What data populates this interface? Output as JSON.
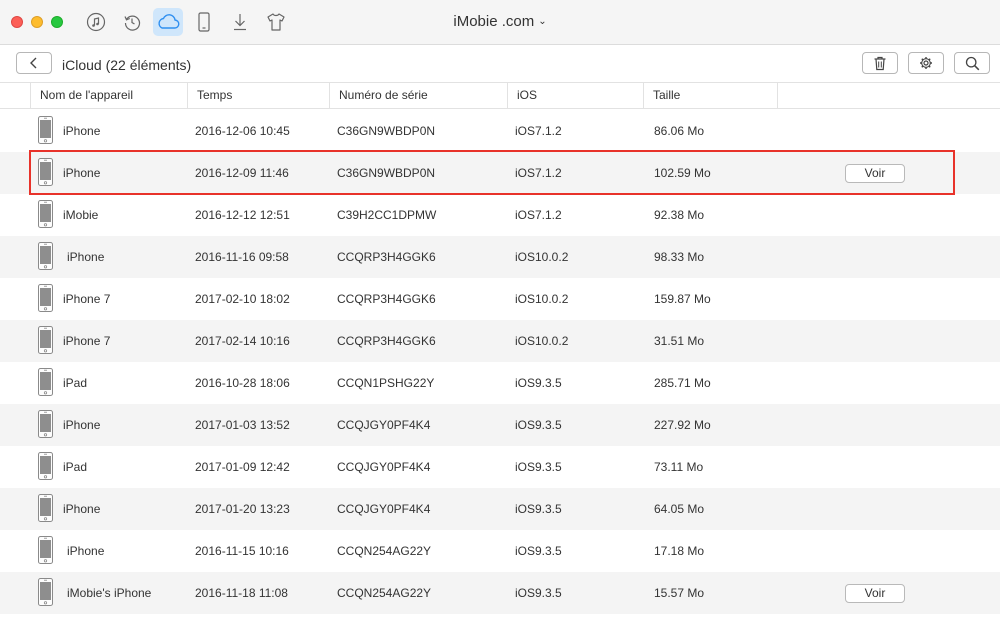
{
  "window": {
    "title": "iMobie .com",
    "title_chevron": "⌄"
  },
  "toolbar_icons": [
    {
      "name": "music-icon",
      "active": false
    },
    {
      "name": "restore-icon",
      "active": false
    },
    {
      "name": "cloud-icon",
      "active": true
    },
    {
      "name": "device-icon",
      "active": false
    },
    {
      "name": "download-icon",
      "active": false
    },
    {
      "name": "tshirt-icon",
      "active": false
    }
  ],
  "header": {
    "title": "iCloud (22 éléments)"
  },
  "columns": [
    "Nom de l'appareil",
    "Temps",
    "Numéro de série",
    "iOS",
    "Taille"
  ],
  "rows": [
    {
      "name": "iPhone",
      "time": "2016-12-06 10:45",
      "serial": "C36GN9WBDP0N",
      "ios": "iOS7.1.2",
      "size": "86.06 Mo"
    },
    {
      "name": "iPhone",
      "time": "2016-12-09 11:46",
      "serial": "C36GN9WBDP0N",
      "ios": "iOS7.1.2",
      "size": "102.59 Mo",
      "action": "Voir"
    },
    {
      "name": "iMobie",
      "time": "2016-12-12 12:51",
      "serial": "C39H2CC1DPMW",
      "ios": "iOS7.1.2",
      "size": "92.38 Mo"
    },
    {
      "name": "iPhone",
      "time": "2016-11-16 09:58",
      "serial": "CCQRP3H4GGK6",
      "ios": "iOS10.0.2",
      "size": "98.33 Mo"
    },
    {
      "name": "iPhone 7",
      "time": "2017-02-10 18:02",
      "serial": "CCQRP3H4GGK6",
      "ios": "iOS10.0.2",
      "size": "159.87 Mo"
    },
    {
      "name": "iPhone 7",
      "time": "2017-02-14 10:16",
      "serial": "CCQRP3H4GGK6",
      "ios": "iOS10.0.2",
      "size": "31.51 Mo"
    },
    {
      "name": "iPad",
      "time": "2016-10-28 18:06",
      "serial": "CCQN1PSHG22Y",
      "ios": "iOS9.3.5",
      "size": "285.71 Mo"
    },
    {
      "name": "iPhone",
      "time": "2017-01-03 13:52",
      "serial": "CCQJGY0PF4K4",
      "ios": "iOS9.3.5",
      "size": "227.92 Mo"
    },
    {
      "name": "iPad",
      "time": "2017-01-09 12:42",
      "serial": "CCQJGY0PF4K4",
      "ios": "iOS9.3.5",
      "size": "73.11 Mo"
    },
    {
      "name": "iPhone",
      "time": "2017-01-20 13:23",
      "serial": "CCQJGY0PF4K4",
      "ios": "iOS9.3.5",
      "size": "64.05 Mo"
    },
    {
      "name": "iPhone",
      "time": "2016-11-15 10:16",
      "serial": "CCQN254AG22Y",
      "ios": "iOS9.3.5",
      "size": "17.18 Mo"
    },
    {
      "name": "iMobie's iPhone",
      "time": "2016-11-18 11:08",
      "serial": "CCQN254AG22Y",
      "ios": "iOS9.3.5",
      "size": "15.57 Mo",
      "action": "Voir"
    }
  ],
  "colors": {
    "accent": "#2f8ff0",
    "highlight_border": "#e8322a",
    "row_alt": "#f4f4f4"
  }
}
